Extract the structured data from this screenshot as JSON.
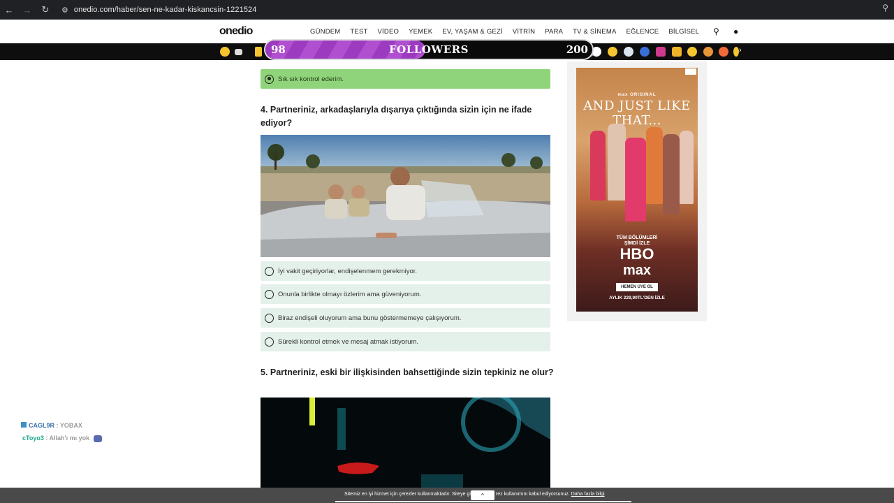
{
  "browser": {
    "url": "onedio.com/haber/sen-ne-kadar-kiskancsin-1221524"
  },
  "site": {
    "logo": "onedio",
    "nav": [
      "GÜNDEM",
      "TEST",
      "VİDEO",
      "YEMEK",
      "EV, YAŞAM & GEZİ",
      "VİTRİN",
      "PARA",
      "TV & SİNEMA",
      "EĞLENCE",
      "BİLGİSEL"
    ]
  },
  "followers_overlay": {
    "current": "98",
    "label": "FOLLOWERS",
    "goal": "200",
    "progress": 0.49
  },
  "quiz": {
    "prev_selected_answer": "Sık sık kontrol ederim.",
    "q4": {
      "title": "4. Partneriniz, arkadaşlarıyla dışarıya çıktığında sizin için ne ifade ediyor?",
      "options": [
        "İyi vakit geçiriyorlar, endişelenmem gerekmiyor.",
        "Onunla birlikte olmayı özlerim ama güveniyorum.",
        "Biraz endişeli oluyorum ama bunu göstermemeye çalışıyorum.",
        "Sürekli kontrol etmek ve mesaj atmak istiyorum."
      ]
    },
    "q5": {
      "title": "5. Partneriniz, eski bir ilişkisinden bahsettiğinde sizin tepkiniz ne olur?"
    }
  },
  "ad": {
    "brand": "max ORIGINAL",
    "title": "AND JUST LIKE THAT...",
    "cta_line1": "TÜM BÖLÜMLERİ",
    "cta_line2": "ŞİMDİ İZLE",
    "logo_top": "HBO",
    "logo_bottom": "max",
    "member_button": "HEMEN ÜYE OL",
    "price": "AYLIK 229,90TL'DEN İZLE"
  },
  "chat": [
    {
      "user": "CAGL9R",
      "message": "YOBAX"
    },
    {
      "user": "cToyo3",
      "message": "Allah'ı mı yok"
    }
  ],
  "cookie": {
    "text_left": "Sitemiz en iyi hizmet için çerezler kullanmaktadır. Siteye gi",
    "text_right": "rez kullanımını kabul ediyorsunuz.",
    "link": "Daha fazla bilgi",
    "scroll_up": "^"
  },
  "colors": {
    "selected_answer": "#8fd47a",
    "option_bg": "#e4f0ea",
    "followers_fill": "#a846c8"
  }
}
